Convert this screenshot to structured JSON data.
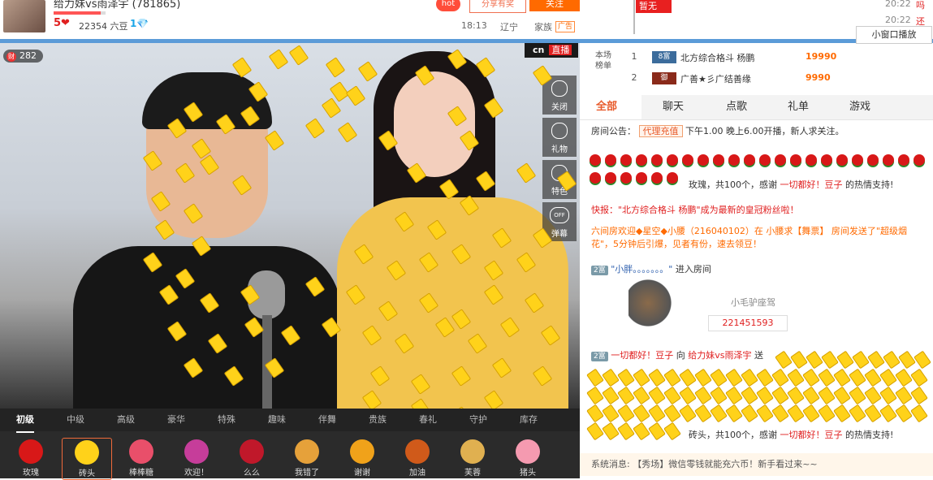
{
  "header": {
    "room_title": "给力妹vs雨泽宇 (781865)",
    "hearts": "5❤",
    "beans": "22354 六豆",
    "diamond_level": "1💎",
    "hot": "hot",
    "share": "分享有奖",
    "follow": "关注",
    "time": "18:13",
    "location": "辽宁",
    "family": "家族",
    "ad": "广告",
    "flag": "暂无",
    "right_time_1": "20:22",
    "right_time_2": "20:22",
    "right_text_1": "吗",
    "right_text_2": "还活"
  },
  "video": {
    "viewers": "282",
    "viewer_icon": "财",
    "live_logo": "cn",
    "live_tag": "直播",
    "tools": [
      "关闭",
      "礼物",
      "特色",
      "弹幕"
    ],
    "off_label": "OFF"
  },
  "gift_tabs": [
    "初级",
    "中级",
    "高级",
    "豪华",
    "特殊",
    "趣味",
    "伴舞",
    "贵族",
    "春礼",
    "守护",
    "库存"
  ],
  "gifts": [
    {
      "label": "玫瑰",
      "color": "#d81818"
    },
    {
      "label": "砖头",
      "color": "#ffd21a"
    },
    {
      "label": "棒棒糖",
      "color": "#e94f6a"
    },
    {
      "label": "欢迎！",
      "color": "#c63d9a"
    },
    {
      "label": "么么",
      "color": "#c0182a"
    },
    {
      "label": "我错了",
      "color": "#e6a13a"
    },
    {
      "label": "谢谢",
      "color": "#f0a21a"
    },
    {
      "label": "加油",
      "color": "#d05a1a"
    },
    {
      "label": "芙蓉",
      "color": "#e0b050"
    },
    {
      "label": "猪头",
      "color": "#f59ab0"
    }
  ],
  "rank": {
    "label": "本场榜单",
    "rows": [
      {
        "num": "1",
        "badge": "8富",
        "name": "北方综合格斗  杨鹏",
        "amount": "19990"
      },
      {
        "num": "2",
        "badge": "御",
        "name": "广善★彡广结善缘",
        "amount": "9990"
      }
    ],
    "mini_window": "小窗口播放"
  },
  "chat_tabs": [
    "全部",
    "聊天",
    "点歌",
    "礼单",
    "游戏"
  ],
  "chat": {
    "notice_prefix": "房间公告：",
    "notice_tag": "代理充值",
    "notice_text": "下午1.00 晚上6.00开播，新人求关注。",
    "rose_thanks": "玫瑰，共100个，感谢",
    "rose_user": "一切都好！豆子",
    "rose_suffix": "的热情支持!",
    "news": "快报：\"北方综合格斗  杨鹏\"成为最新的皇冠粉丝啦！",
    "broadcast": "六间房欢迎◆星空◆小腰（216040102）在 小腰求【舞票】 房间发送了\"超级烟花\"，5分钟后引爆，见者有份，速去领豆！",
    "enter_level": "2富",
    "enter_user": "\"小胖。。。。。。。\"",
    "enter_suffix": "进入房间",
    "donkey_name": "小毛驴座驾",
    "donkey_num": "221451593",
    "gift_level": "2富",
    "gift_user": "一切都好！豆子",
    "gift_to": "向",
    "gift_target": "给力妹vs雨泽宇",
    "gift_verb": "送",
    "brick_thanks": "砖头，共100个，感谢",
    "brick_user": "一切都好！豆子",
    "brick_suffix": "的热情支持!",
    "system": "系统消息: 【秀场】微信零钱就能充六币！新手看过来~~"
  }
}
